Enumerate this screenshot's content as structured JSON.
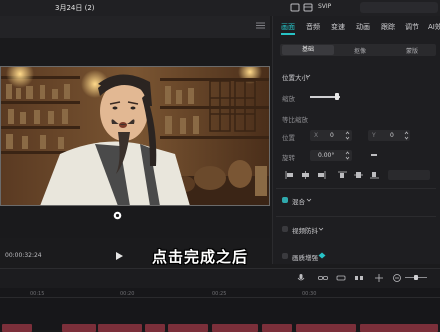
{
  "status_bar": {
    "date": "3月24日 (2)",
    "vip": "SVIP"
  },
  "preview": {
    "timecode": "00:00:32:24",
    "caption": "点击完成之后"
  },
  "inspector": {
    "tabs": [
      "画面",
      "音频",
      "变速",
      "动画",
      "跟踪",
      "调节",
      "AI效"
    ],
    "active_tab": "画面",
    "subtabs": [
      "基础",
      "抠像",
      "蒙版"
    ],
    "active_subtab": "基础",
    "section_position_size": "位置大小",
    "scale_label": "缩放",
    "uniform_scale_label": "等比缩放",
    "position_label": "位置",
    "x_label": "X",
    "x_value": "0",
    "y_label": "Y",
    "y_value": "0",
    "rotation_label": "旋转",
    "rotation_value": "0.00°",
    "blend_label": "混合",
    "stabilize_label": "视频防抖",
    "enhance_label": "画质增强",
    "colors": {
      "accent": "#27c3c6"
    }
  },
  "timeline": {
    "ticks": [
      "00:15",
      "00:20",
      "00:25",
      "00:30"
    ]
  }
}
